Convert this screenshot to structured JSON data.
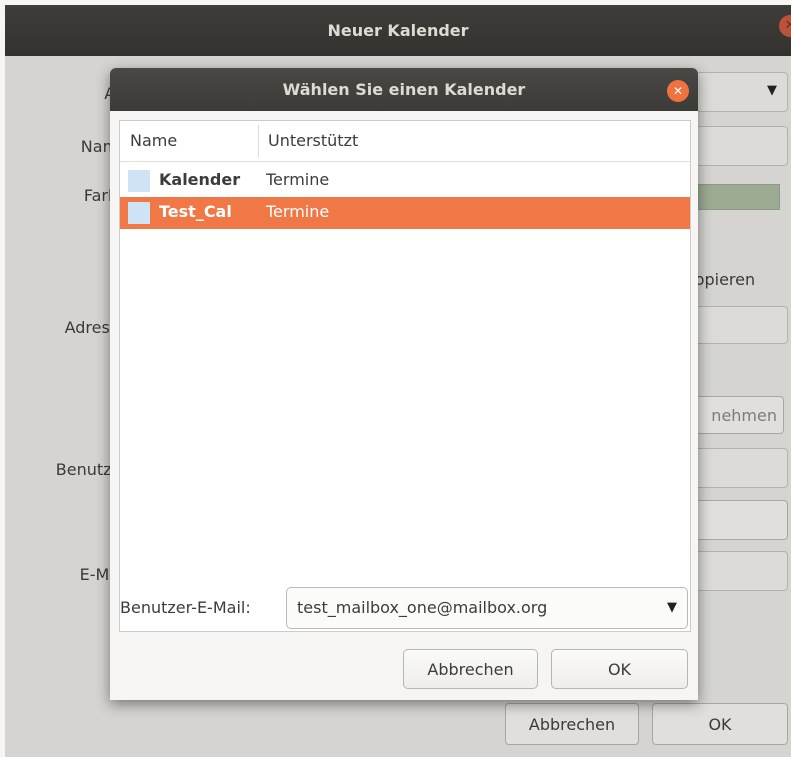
{
  "main_window": {
    "title": "Neuer Kalender",
    "labels": {
      "type": "Art",
      "name": "Name",
      "color": "Farbe",
      "address": "Adresse",
      "user": "Benutzer",
      "email": "E-Mail"
    },
    "copy_partial": "kopieren",
    "take_partial": "nehmen",
    "cancel_label": "Abbrechen",
    "ok_label": "OK",
    "color_swatch": "#9dab94"
  },
  "dialog": {
    "title": "Wählen Sie einen Kalender",
    "columns": [
      "Name",
      "Unterstützt"
    ],
    "rows": [
      {
        "name": "Kalender",
        "supported": "Termine",
        "selected": false
      },
      {
        "name": "Test_Cal",
        "supported": "Termine",
        "selected": true
      }
    ],
    "email_label": "Benutzer-E-Mail:",
    "email_value": "test_mailbox_one@mailbox.org",
    "cancel_label": "Abbrechen",
    "ok_label": "OK",
    "accent_color": "#f07746"
  }
}
